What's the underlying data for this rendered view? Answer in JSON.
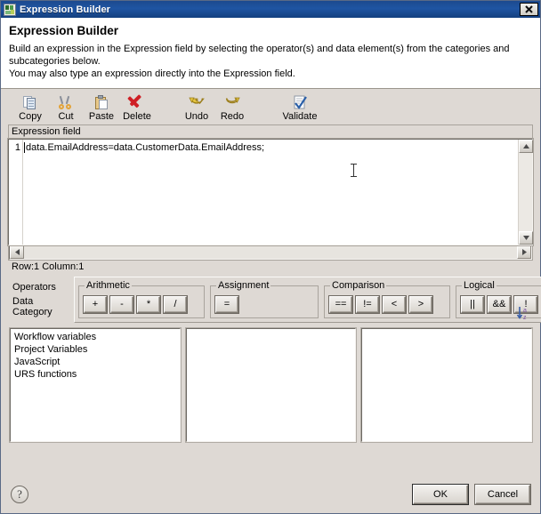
{
  "window": {
    "title": "Expression Builder",
    "app_icon": "blocks-icon",
    "close_label": "✕"
  },
  "header": {
    "heading": "Expression Builder",
    "description_line1": "Build an expression in the Expression field by selecting the operator(s) and data element(s) from the categories and subcategories below.",
    "description_line2": "You may also type an expression directly into the Expression field."
  },
  "toolbar": {
    "items": [
      {
        "label": "Copy",
        "icon": "copy-icon",
        "accel": "C"
      },
      {
        "label": "Cut",
        "icon": "cut-icon",
        "accel": "u"
      },
      {
        "label": "Paste",
        "icon": "paste-icon",
        "accel": "P"
      },
      {
        "label": "Delete",
        "icon": "delete-icon",
        "accel": "D"
      },
      {
        "label": "Undo",
        "icon": "undo-icon",
        "accel": "U"
      },
      {
        "label": "Redo",
        "icon": "redo-icon",
        "accel": "R"
      },
      {
        "label": "Validate",
        "icon": "validate-icon",
        "accel": "V"
      }
    ]
  },
  "expression": {
    "group_label": "Expression field",
    "line_number": "1",
    "text": "data.EmailAddress=data.CustomerData.EmailAddress;",
    "status": "Row:1 Column:1"
  },
  "operators": {
    "section_label": "Operators",
    "data_category_label": "Data Category",
    "sort_icon": "sort-az-icon",
    "groups": [
      {
        "legend": "Arithmetic",
        "buttons": [
          "+",
          "-",
          "*",
          "/"
        ]
      },
      {
        "legend": "Assignment",
        "buttons": [
          "="
        ]
      },
      {
        "legend": "Comparison",
        "buttons": [
          "==",
          "!=",
          "<",
          ">"
        ]
      },
      {
        "legend": "Logical",
        "buttons": [
          "||",
          "&&",
          "!"
        ]
      }
    ]
  },
  "lists": {
    "category_items": [
      "Workflow variables",
      "Project Variables",
      "JavaScript",
      "URS functions"
    ],
    "subcategory_items": [],
    "element_items": []
  },
  "footer": {
    "help_label": "?",
    "ok_label": "OK",
    "cancel_label": "Cancel"
  },
  "colors": {
    "titlebar": "#1f55a3",
    "dialog_bg": "#ded9d4",
    "field_bg": "#ffffff",
    "delete_red": "#cf1f25",
    "undo_yellow": "#e8c840"
  }
}
